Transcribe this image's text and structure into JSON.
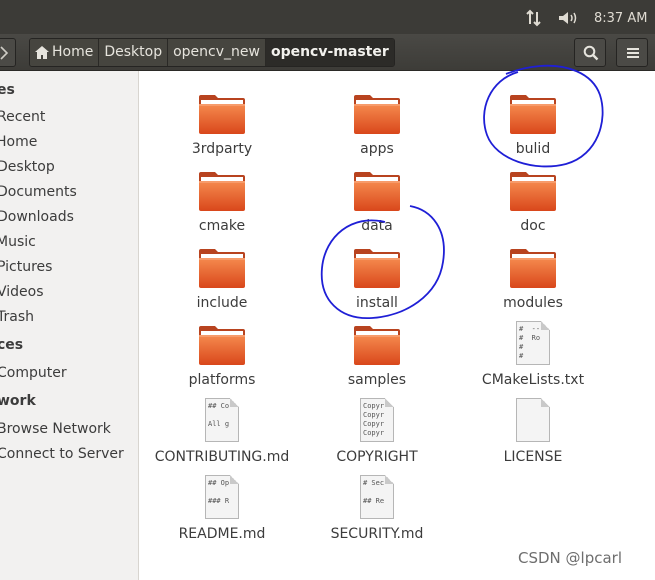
{
  "system_panel": {
    "clock": "8:37 AM",
    "network_icon": "network-arrows-icon",
    "volume_icon": "volume-icon"
  },
  "toolbar": {
    "breadcrumbs": [
      "Home",
      "Desktop",
      "opencv_new",
      "opencv-master"
    ],
    "active_crumb": "opencv-master",
    "search_icon": "search-icon",
    "menu_icon": "hamburger-menu-icon"
  },
  "sidebar": {
    "places_header": "es",
    "items": [
      "Recent",
      "Home",
      "Desktop",
      "Documents",
      "Downloads",
      "Music",
      "Pictures",
      "Videos",
      "Trash"
    ],
    "devices_header": "ces",
    "devices": [
      "Computer"
    ],
    "network_header": "work",
    "network": [
      "Browse Network",
      "Connect to Server"
    ]
  },
  "files": [
    {
      "name": "3rdparty",
      "kind": "folder"
    },
    {
      "name": "apps",
      "kind": "folder"
    },
    {
      "name": "bulid",
      "kind": "folder"
    },
    {
      "name": "cmake",
      "kind": "folder"
    },
    {
      "name": "data",
      "kind": "folder"
    },
    {
      "name": "doc",
      "kind": "folder"
    },
    {
      "name": "include",
      "kind": "folder"
    },
    {
      "name": "install",
      "kind": "folder"
    },
    {
      "name": "modules",
      "kind": "folder"
    },
    {
      "name": "platforms",
      "kind": "folder"
    },
    {
      "name": "samples",
      "kind": "folder"
    },
    {
      "name": "CMakeLists.txt",
      "kind": "text",
      "preview": "#  --\n#  Ro\n#\n#"
    },
    {
      "name": "CONTRIBUTING.md",
      "kind": "text",
      "preview": "## Co\n\nAll g"
    },
    {
      "name": "COPYRIGHT",
      "kind": "text",
      "preview": "Copyr\nCopyr\nCopyr\nCopyr"
    },
    {
      "name": "LICENSE",
      "kind": "text",
      "preview": ""
    },
    {
      "name": "README.md",
      "kind": "text",
      "preview": "## Op\n\n### R"
    },
    {
      "name": "SECURITY.md",
      "kind": "text",
      "preview": "# Sec\n\n## Re"
    }
  ],
  "watermark": "CSDN @lpcarl",
  "colors": {
    "panel": "#3c3b37",
    "folder_orange": "#e8622c",
    "annotation_blue": "#1f1fd6"
  }
}
